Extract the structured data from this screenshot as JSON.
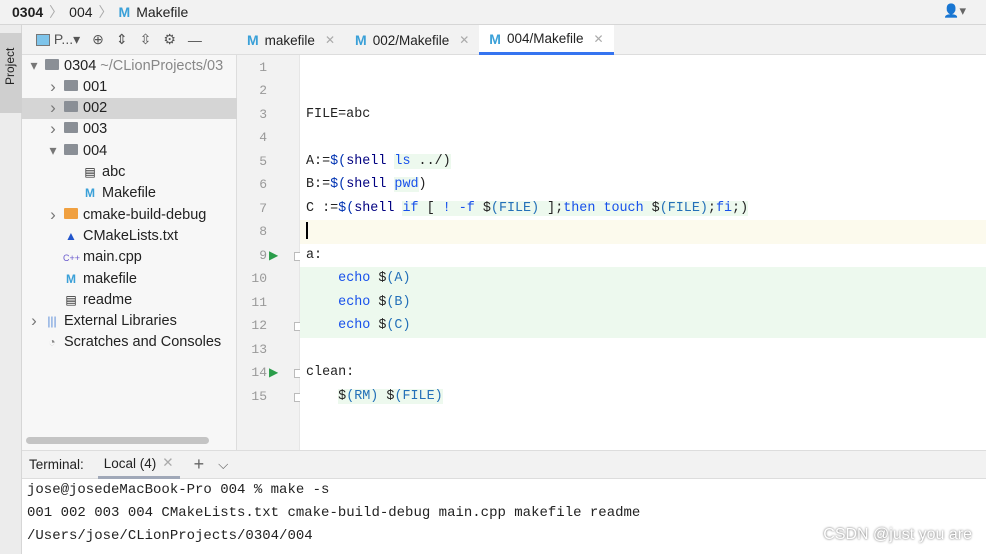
{
  "breadcrumb": [
    "0304",
    "004",
    "Makefile"
  ],
  "sidebar_strip": {
    "label": "Project"
  },
  "project_toolbar": {
    "view": "P..."
  },
  "tree": [
    {
      "label": "0304",
      "extra": "~/CLionProjects/03",
      "depth": 0,
      "arrow": "open",
      "icon": "folder"
    },
    {
      "label": "001",
      "depth": 1,
      "arrow": "closed",
      "icon": "folder"
    },
    {
      "label": "002",
      "depth": 1,
      "arrow": "closed",
      "icon": "folder",
      "selected": true
    },
    {
      "label": "003",
      "depth": 1,
      "arrow": "closed",
      "icon": "folder"
    },
    {
      "label": "004",
      "depth": 1,
      "arrow": "open",
      "icon": "folder"
    },
    {
      "label": "abc",
      "depth": 2,
      "icon": "file"
    },
    {
      "label": "Makefile",
      "depth": 2,
      "icon": "makefile"
    },
    {
      "label": "cmake-build-debug",
      "depth": 1,
      "arrow": "closed",
      "icon": "folder-orange"
    },
    {
      "label": "CMakeLists.txt",
      "depth": 1,
      "icon": "cmake"
    },
    {
      "label": "main.cpp",
      "depth": 1,
      "icon": "cpp"
    },
    {
      "label": "makefile",
      "depth": 1,
      "icon": "makefile"
    },
    {
      "label": "readme",
      "depth": 1,
      "icon": "file"
    },
    {
      "label": "External Libraries",
      "depth": 0,
      "arrow": "closed",
      "icon": "library"
    },
    {
      "label": "Scratches and Consoles",
      "depth": 0,
      "icon": "scratches"
    }
  ],
  "tabs": [
    {
      "label": "makefile"
    },
    {
      "label": "002/Makefile"
    },
    {
      "label": "004/Makefile",
      "active": true
    }
  ],
  "code": [
    [],
    [],
    [
      {
        "t": "FILE=abc"
      }
    ],
    [],
    [
      {
        "t": "A:="
      },
      {
        "t": "$(",
        "c": "kw"
      },
      {
        "t": "shell",
        "c": "fn"
      },
      {
        "t": " "
      },
      {
        "t": "ls",
        "c": "cmd",
        "g": 1
      },
      {
        "t": " ../)",
        "g": 1
      }
    ],
    [
      {
        "t": "B:="
      },
      {
        "t": "$(",
        "c": "kw"
      },
      {
        "t": "shell",
        "c": "fn"
      },
      {
        "t": " "
      },
      {
        "t": "pwd",
        "c": "cmd",
        "g": 1
      },
      {
        "t": ")"
      }
    ],
    [
      {
        "t": "C :="
      },
      {
        "t": "$(",
        "c": "kw"
      },
      {
        "t": "shell",
        "c": "fn"
      },
      {
        "t": " "
      },
      {
        "t": "if",
        "c": "cmd",
        "g": 1
      },
      {
        "t": " [ ",
        "g": 1
      },
      {
        "t": "!",
        "c": "cmd",
        "g": 1
      },
      {
        "t": " -f ",
        "c": "cmd",
        "g": 1
      },
      {
        "t": "$",
        "g": 1
      },
      {
        "t": "(FILE)",
        "c": "var",
        "g": 1
      },
      {
        "t": " ];",
        "g": 1
      },
      {
        "t": "then",
        "c": "cmd",
        "g": 1
      },
      {
        "t": " ",
        "g": 1
      },
      {
        "t": "touch",
        "c": "cmd",
        "g": 1
      },
      {
        "t": " $",
        "g": 1
      },
      {
        "t": "(FILE)",
        "c": "var",
        "g": 1
      },
      {
        "t": ";",
        "g": 1
      },
      {
        "t": "fi",
        "c": "cmd",
        "g": 1
      },
      {
        "t": ";)",
        "g": 1
      }
    ],
    [],
    [
      {
        "t": "a:"
      }
    ],
    [
      {
        "t": "    "
      },
      {
        "t": "echo",
        "c": "cmd"
      },
      {
        "t": " $"
      },
      {
        "t": "(A)",
        "c": "var"
      }
    ],
    [
      {
        "t": "    "
      },
      {
        "t": "echo",
        "c": "cmd"
      },
      {
        "t": " $"
      },
      {
        "t": "(B)",
        "c": "var"
      }
    ],
    [
      {
        "t": "    "
      },
      {
        "t": "echo",
        "c": "cmd"
      },
      {
        "t": " $"
      },
      {
        "t": "(C)",
        "c": "var"
      }
    ],
    [],
    [
      {
        "t": "clean:"
      }
    ],
    [
      {
        "t": "    "
      },
      {
        "t": "$",
        "g": 1
      },
      {
        "t": "(RM)",
        "c": "var",
        "g": 1
      },
      {
        "t": " $",
        "g": 1
      },
      {
        "t": "(FILE)",
        "c": "var",
        "g": 1
      }
    ]
  ],
  "run_lines": [
    9,
    14
  ],
  "fold_lines": [
    9,
    12,
    14,
    15
  ],
  "full_green_lines": [
    10,
    11,
    12
  ],
  "caret_line": 8,
  "terminal": {
    "label": "Terminal:",
    "tab": "Local (4)",
    "lines": [
      "jose@josedeMacBook-Pro 004 % make -s",
      "001 002 003 004 CMakeLists.txt cmake-build-debug main.cpp makefile readme",
      "/Users/jose/CLionProjects/0304/004"
    ]
  },
  "watermark": "CSDN @just you are"
}
